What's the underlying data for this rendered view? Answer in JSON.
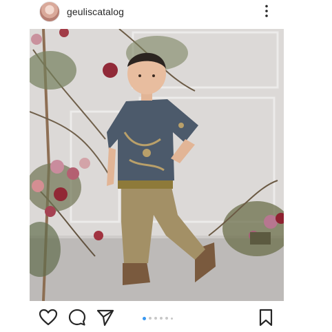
{
  "post": {
    "username": "geuliscatalog",
    "image_alt": "",
    "carousel": {
      "total": 6,
      "active_index": 0
    }
  },
  "icons": {
    "more": "more-options-icon",
    "like": "heart-icon",
    "comment": "comment-icon",
    "share": "paper-plane-icon",
    "save": "bookmark-icon"
  },
  "colors": {
    "accent": "#3897f0",
    "text": "#262626"
  }
}
